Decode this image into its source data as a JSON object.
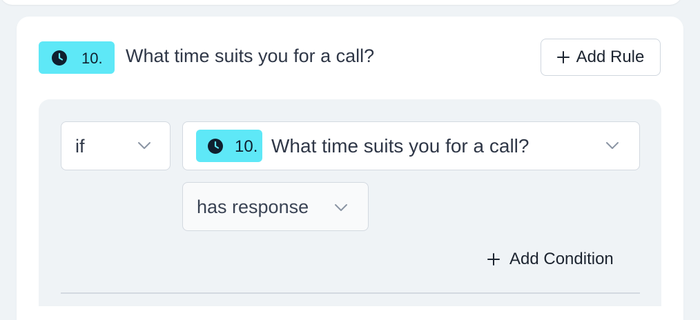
{
  "question": {
    "number": "10.",
    "icon": "clock-icon",
    "title": "What time suits you for a call?",
    "badge_color": "#5ee8f7"
  },
  "actions": {
    "add_rule_label": "Add Rule",
    "add_condition_label": "Add Condition"
  },
  "rule": {
    "connector": "if",
    "question_number": "10.",
    "question_title": "What time suits you for a call?",
    "operator": "has response"
  }
}
